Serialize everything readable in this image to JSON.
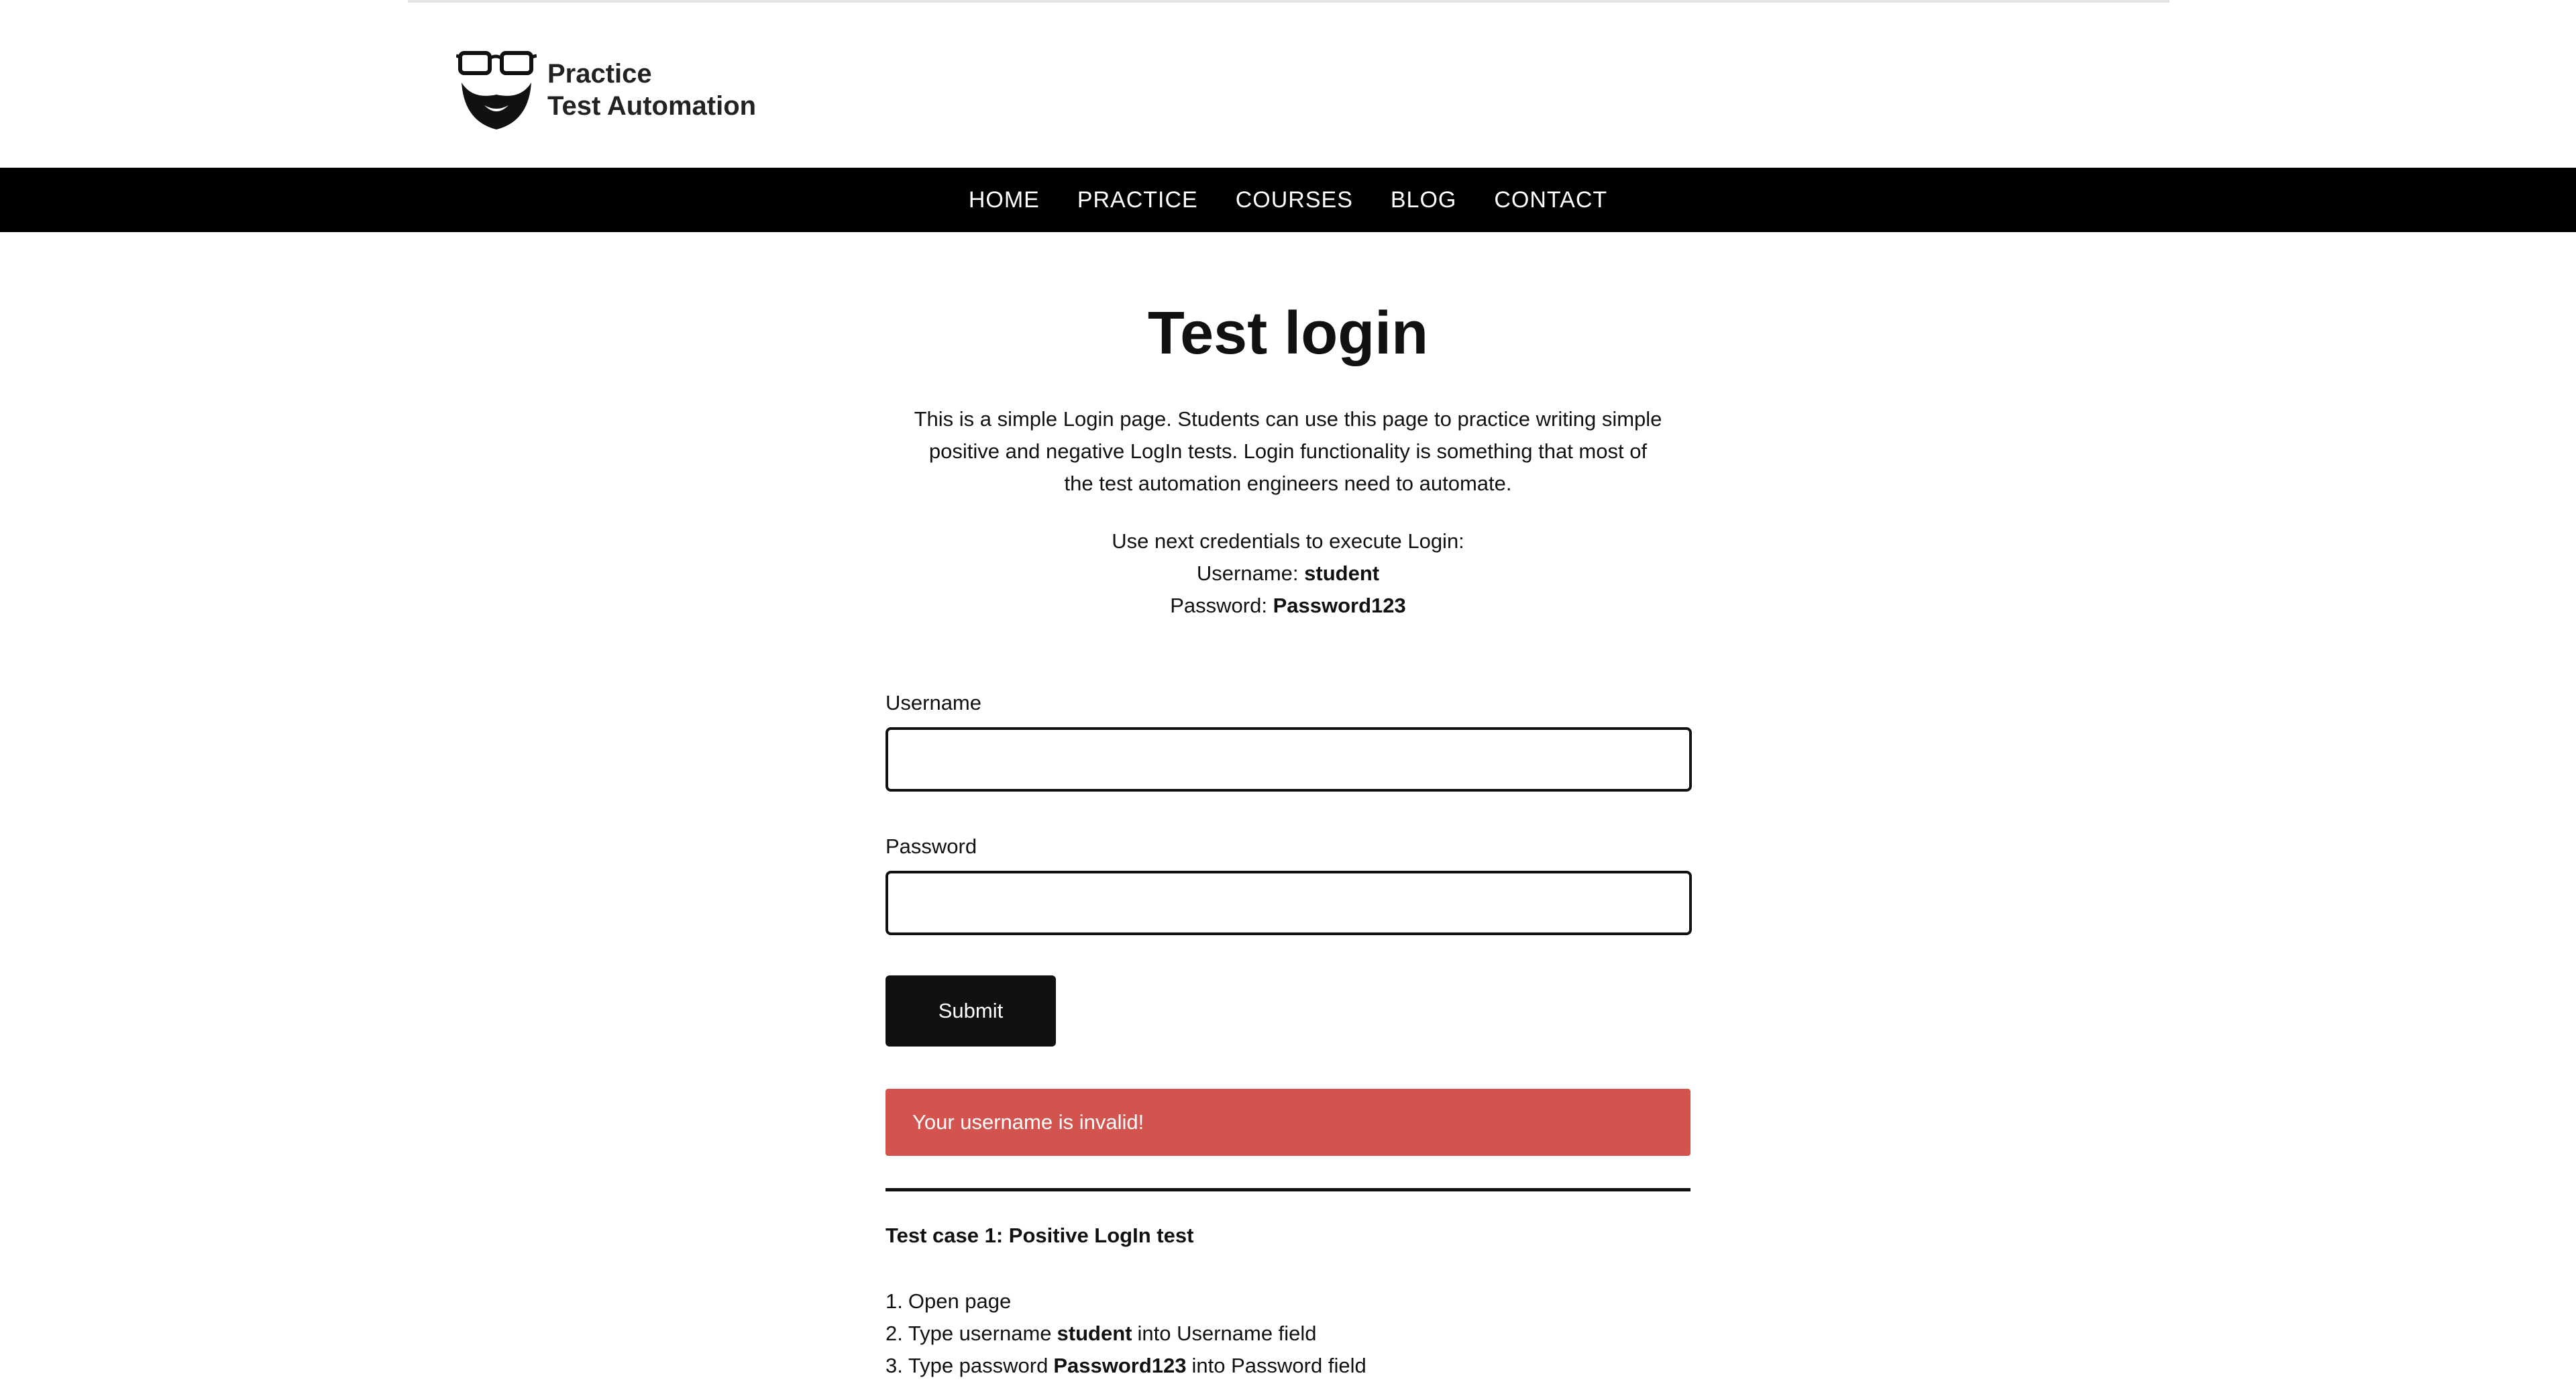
{
  "brand": {
    "line1": "Practice",
    "line2": "Test Automation"
  },
  "nav": {
    "items": [
      "HOME",
      "PRACTICE",
      "COURSES",
      "BLOG",
      "CONTACT"
    ]
  },
  "main": {
    "title": "Test login",
    "intro": [
      "This is a simple Login page. Students can use this page to practice writing simple",
      "positive and negative LogIn tests. Login functionality is something that most of",
      "the test automation engineers need to automate."
    ],
    "credentials": {
      "heading": "Use next credentials to execute Login:",
      "username_label": "Username:",
      "username_value": "student",
      "password_label": "Password:",
      "password_value": "Password123"
    }
  },
  "form": {
    "username_label": "Username",
    "username_value": "",
    "password_label": "Password",
    "password_value": "",
    "submit_label": "Submit",
    "error_message": "Your username is invalid!"
  },
  "test_case": {
    "title": "Test case 1: Positive LogIn test",
    "steps": [
      {
        "num": "1.",
        "before": "Open page",
        "bold": "",
        "after": ""
      },
      {
        "num": "2.",
        "before": "Type username",
        "bold": "student",
        "after": "into Username field"
      },
      {
        "num": "3.",
        "before": "Type password",
        "bold": "Password123",
        "after": "into Password field"
      }
    ]
  },
  "colors": {
    "navbar_bg": "#000000",
    "error_bg": "#d3544f",
    "button_bg": "#111111"
  }
}
